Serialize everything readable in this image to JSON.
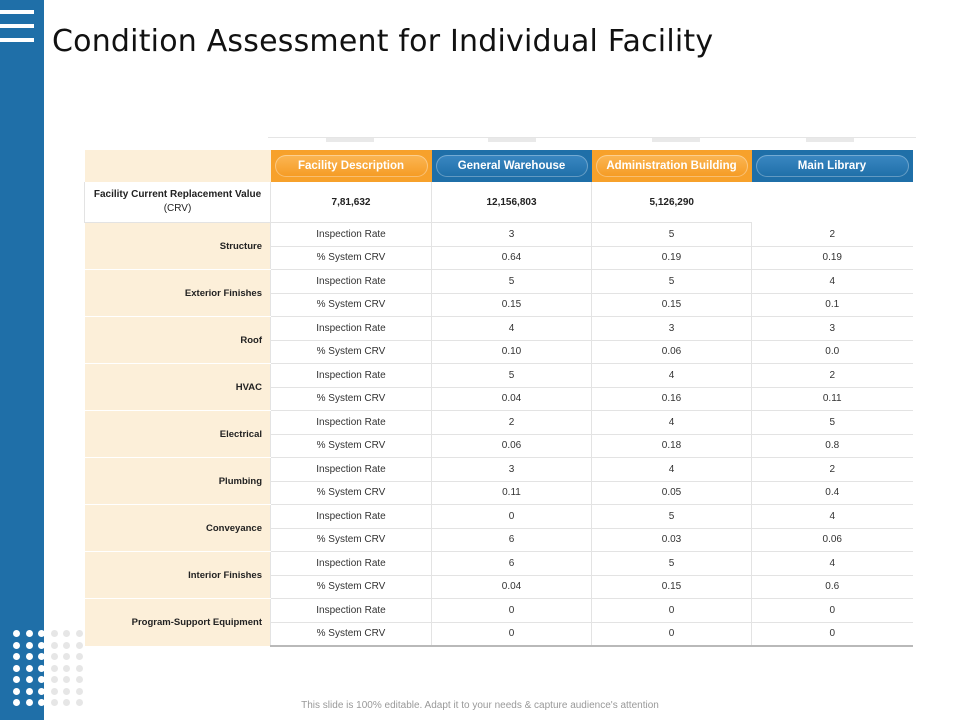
{
  "title": "Condition Assessment for Individual Facility",
  "footer": "This slide is 100% editable. Adapt it to your needs & capture audience's attention",
  "colors": {
    "sidebar": "#1f6fa8",
    "accent_orange": "#f7a12b",
    "accent_blue": "#1f6fa8",
    "category_bg": "#fcefd9"
  },
  "icons": {
    "menu": "hamburger-icon",
    "dots": "dot-grid-decoration"
  },
  "table": {
    "headers": [
      "Facility Description",
      "General Warehouse",
      "Administration Building",
      "Main Library"
    ],
    "crv": {
      "label_bold": "Facility Current Replacement Value",
      "label_suffix": "(CRV)",
      "values": [
        "7,81,632",
        "12,156,803",
        "5,126,290"
      ]
    },
    "metric_labels": {
      "rate": "Inspection Rate",
      "crv": "% System CRV"
    },
    "rows": [
      {
        "category": "Structure",
        "rate": [
          "3",
          "5",
          "2"
        ],
        "crv": [
          "0.64",
          "0.19",
          "0.19"
        ]
      },
      {
        "category": "Exterior Finishes",
        "rate": [
          "5",
          "5",
          "4"
        ],
        "crv": [
          "0.15",
          "0.15",
          "0.1"
        ]
      },
      {
        "category": "Roof",
        "rate": [
          "4",
          "3",
          "3"
        ],
        "crv": [
          "0.10",
          "0.06",
          "0.0"
        ]
      },
      {
        "category": "HVAC",
        "rate": [
          "5",
          "4",
          "2"
        ],
        "crv": [
          "0.04",
          "0.16",
          "0.11"
        ]
      },
      {
        "category": "Electrical",
        "rate": [
          "2",
          "4",
          "5"
        ],
        "crv": [
          "0.06",
          "0.18",
          "0.8"
        ]
      },
      {
        "category": "Plumbing",
        "rate": [
          "3",
          "4",
          "2"
        ],
        "crv": [
          "0.11",
          "0.05",
          "0.4"
        ]
      },
      {
        "category": "Conveyance",
        "rate": [
          "0",
          "5",
          "4"
        ],
        "crv": [
          "6",
          "0.03",
          "0.06"
        ]
      },
      {
        "category": "Interior Finishes",
        "rate": [
          "6",
          "5",
          "4"
        ],
        "crv": [
          "0.04",
          "0.15",
          "0.6"
        ]
      },
      {
        "category": "Program-Support Equipment",
        "rate": [
          "0",
          "0",
          "0"
        ],
        "crv": [
          "0",
          "0",
          "0"
        ]
      }
    ]
  }
}
